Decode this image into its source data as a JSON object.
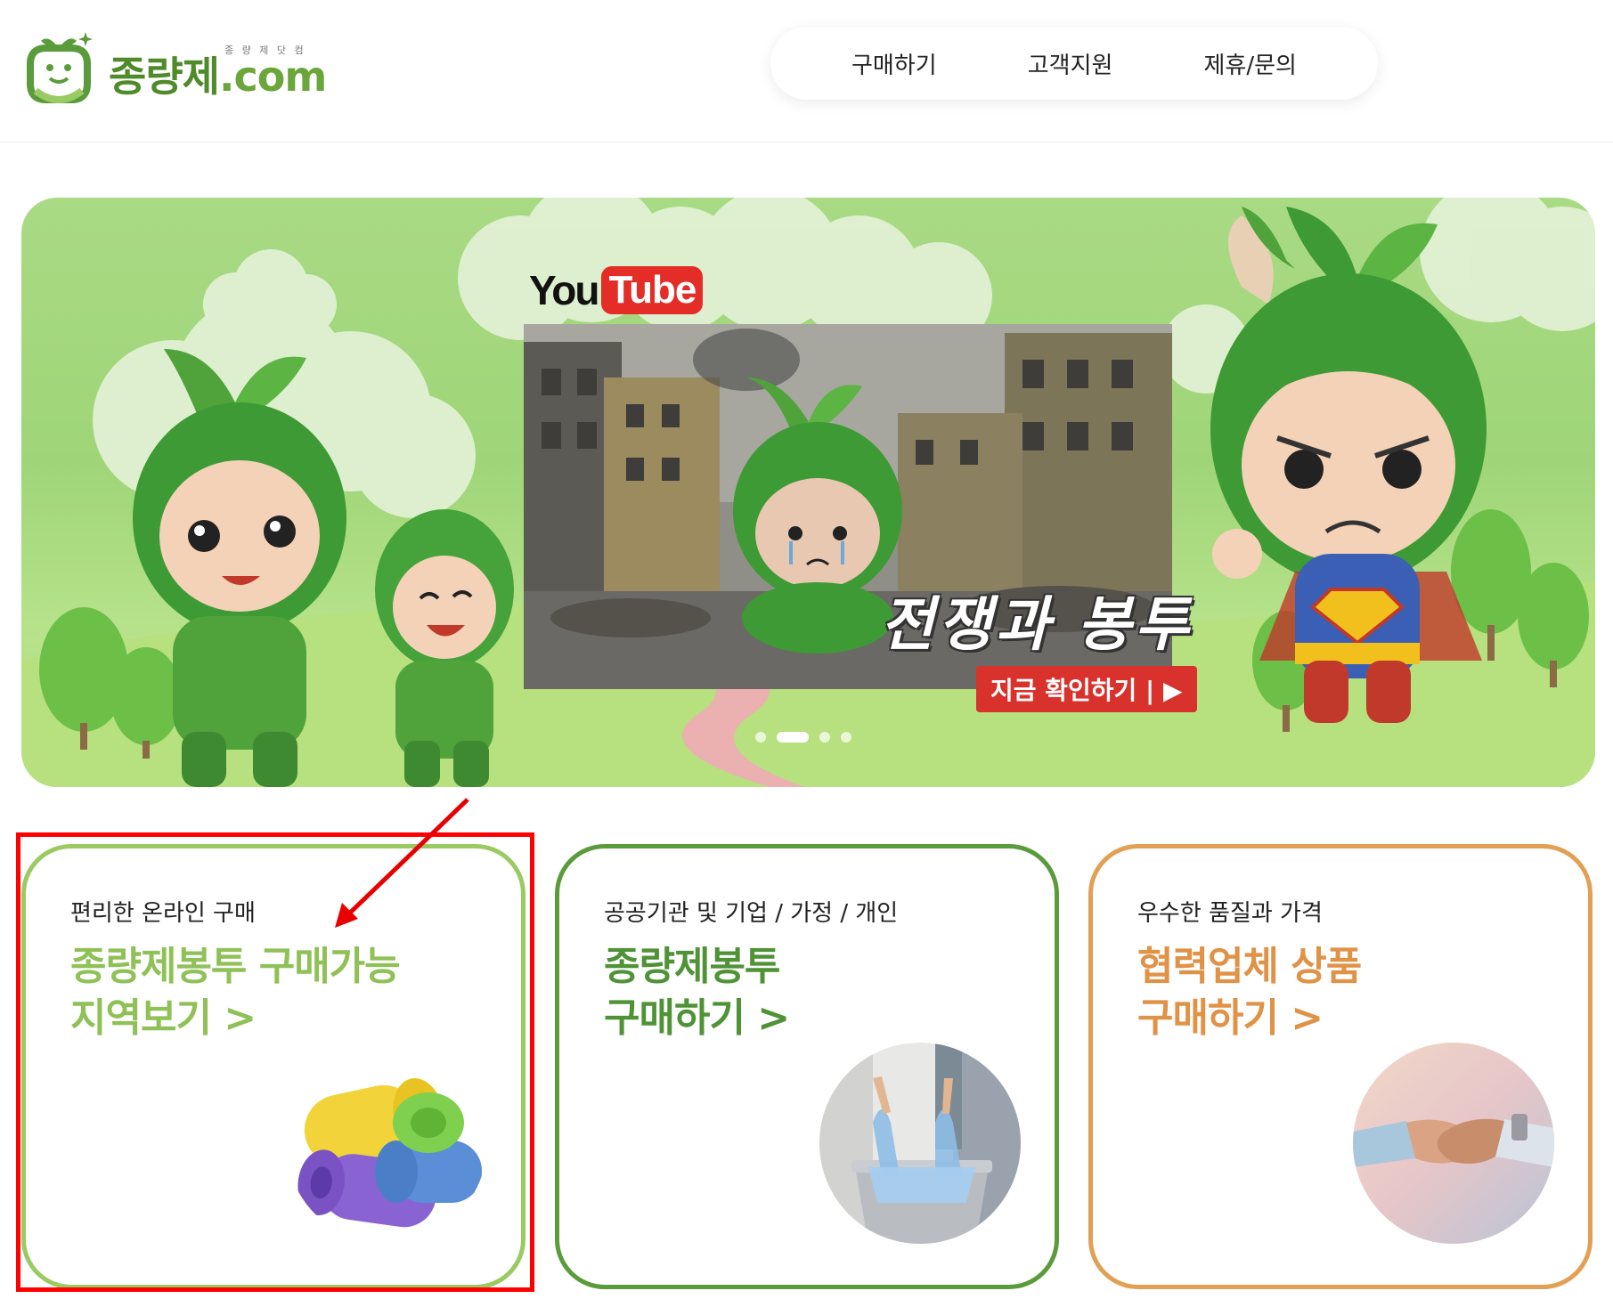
{
  "header": {
    "logo_text": "종량제",
    "logo_dotcom": ".com",
    "logo_sub": "종 량 제 닷 컴",
    "nav": [
      {
        "label": "구매하기"
      },
      {
        "label": "고객지원"
      },
      {
        "label": "제휴/문의"
      }
    ]
  },
  "hero": {
    "youtube_you": "You",
    "youtube_tube": "Tube",
    "video_title": "전쟁과 봉투",
    "watch_label": "지금 확인하기 | ▶",
    "dots_count": 4,
    "active_dot": 2
  },
  "cards": [
    {
      "sub": "편리한 온라인 구매",
      "title_line1": "종량제봉투 구매가능",
      "title_line2": "지역보기 >",
      "image": "garbage-bag-rolls",
      "accent": "#8fc157"
    },
    {
      "sub": "공공기관 및 기업 / 가정 / 개인",
      "title_line1": "종량제봉투",
      "title_line2": "구매하기 >",
      "image": "bag-in-bin",
      "accent": "#4f9336"
    },
    {
      "sub": "우수한 품질과 가격",
      "title_line1": "협력업체 상품",
      "title_line2": "구매하기 >",
      "image": "handshake",
      "accent": "#e09247"
    }
  ],
  "annotation": {
    "highlight_color": "#ff0000"
  }
}
